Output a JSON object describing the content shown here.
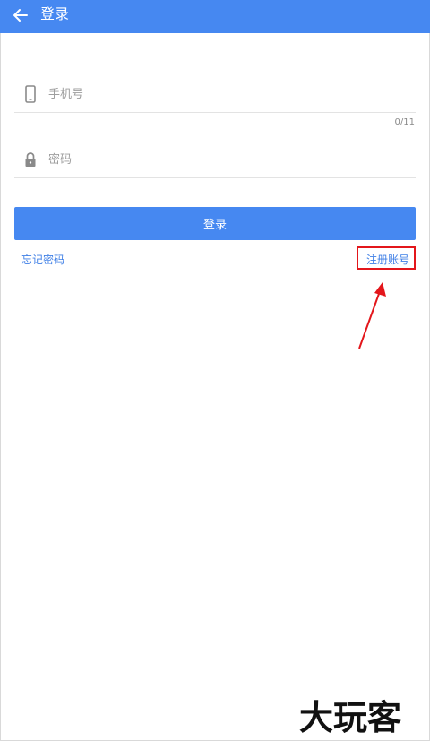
{
  "appbar": {
    "title": "登录",
    "back_icon": "arrow-left-icon",
    "background": "#4688f1"
  },
  "form": {
    "phone": {
      "placeholder": "手机号",
      "value": "",
      "icon": "smartphone-icon",
      "counter": "0/11"
    },
    "password": {
      "placeholder": "密码",
      "value": "",
      "icon": "lock-icon"
    },
    "login_label": "登录"
  },
  "links": {
    "forgot_password": "忘记密码",
    "register": "注册账号"
  },
  "annotation": {
    "highlight_color": "#e3161b"
  },
  "watermark": {
    "text": "大玩客"
  }
}
